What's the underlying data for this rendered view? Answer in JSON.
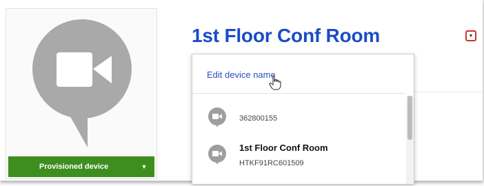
{
  "device_card": {
    "status_label": "Provisioned device",
    "caret": "▼",
    "avatar_icon": "video-camera-chat-bubble-icon",
    "colors": {
      "avatar": "#a9a9a9",
      "status_bar": "#3e8e1f"
    }
  },
  "header": {
    "title": "1st Floor Conf Room",
    "caret": "▼",
    "colors": {
      "title": "#1a4cc6",
      "caret_border": "#d2302a"
    }
  },
  "dropdown": {
    "edit_label": "Edit device name",
    "cursor_icon": "hand-pointer-icon",
    "items": [
      {
        "icon": "video-chat-icon",
        "id": "362800155"
      },
      {
        "icon": "video-chat-icon",
        "name": "1st Floor Conf Room",
        "serial": "HTKF91RC601509"
      }
    ]
  }
}
